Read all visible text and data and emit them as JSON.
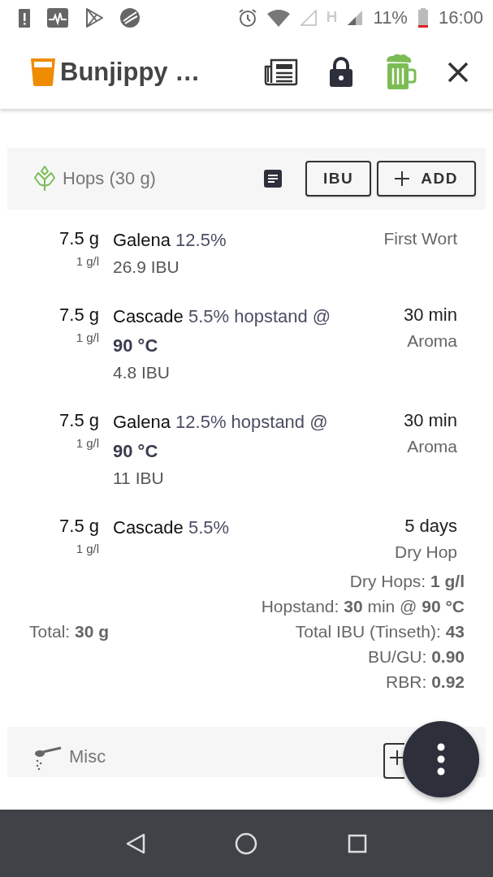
{
  "status_bar": {
    "battery": "11%",
    "time": "16:00"
  },
  "app_bar": {
    "title": "Bunjippy …"
  },
  "hops": {
    "title": "Hops (30 g)",
    "buttons": [
      "IBU",
      "ADD"
    ],
    "rows": [
      {
        "amount": "7.5 g",
        "per_liter": "1 g/l",
        "name": "Galena",
        "detail": "12.5%",
        "ibu": "26.9 IBU",
        "time": "First Wort"
      },
      {
        "amount": "7.5 g",
        "per_liter": "1 g/l",
        "name": "Cascade",
        "detail": "5.5% hopstand @ **90 °C**",
        "ibu": "4.8 IBU",
        "time": "30 min",
        "use": "Aroma"
      },
      {
        "amount": "7.5 g",
        "per_liter": "1 g/l",
        "name": "Galena",
        "detail": "12.5% hopstand @ **90 °C**",
        "ibu": "11 IBU",
        "time": "30 min",
        "use": "Aroma"
      },
      {
        "amount": "7.5 g",
        "per_liter": "1 g/l",
        "name": "Cascade",
        "detail": "5.5%",
        "time": "5 days",
        "use": "Dry Hop"
      }
    ],
    "total": "Total: **30 g**",
    "summary": [
      "Dry Hops: **1 g/l**",
      "Hopstand: **30** min @ **90 °C**",
      "Total IBU (Tinseth): **43**",
      "BU/GU: **0.90**",
      "RBR: **0.92**"
    ]
  },
  "misc": {
    "title": "Misc"
  }
}
